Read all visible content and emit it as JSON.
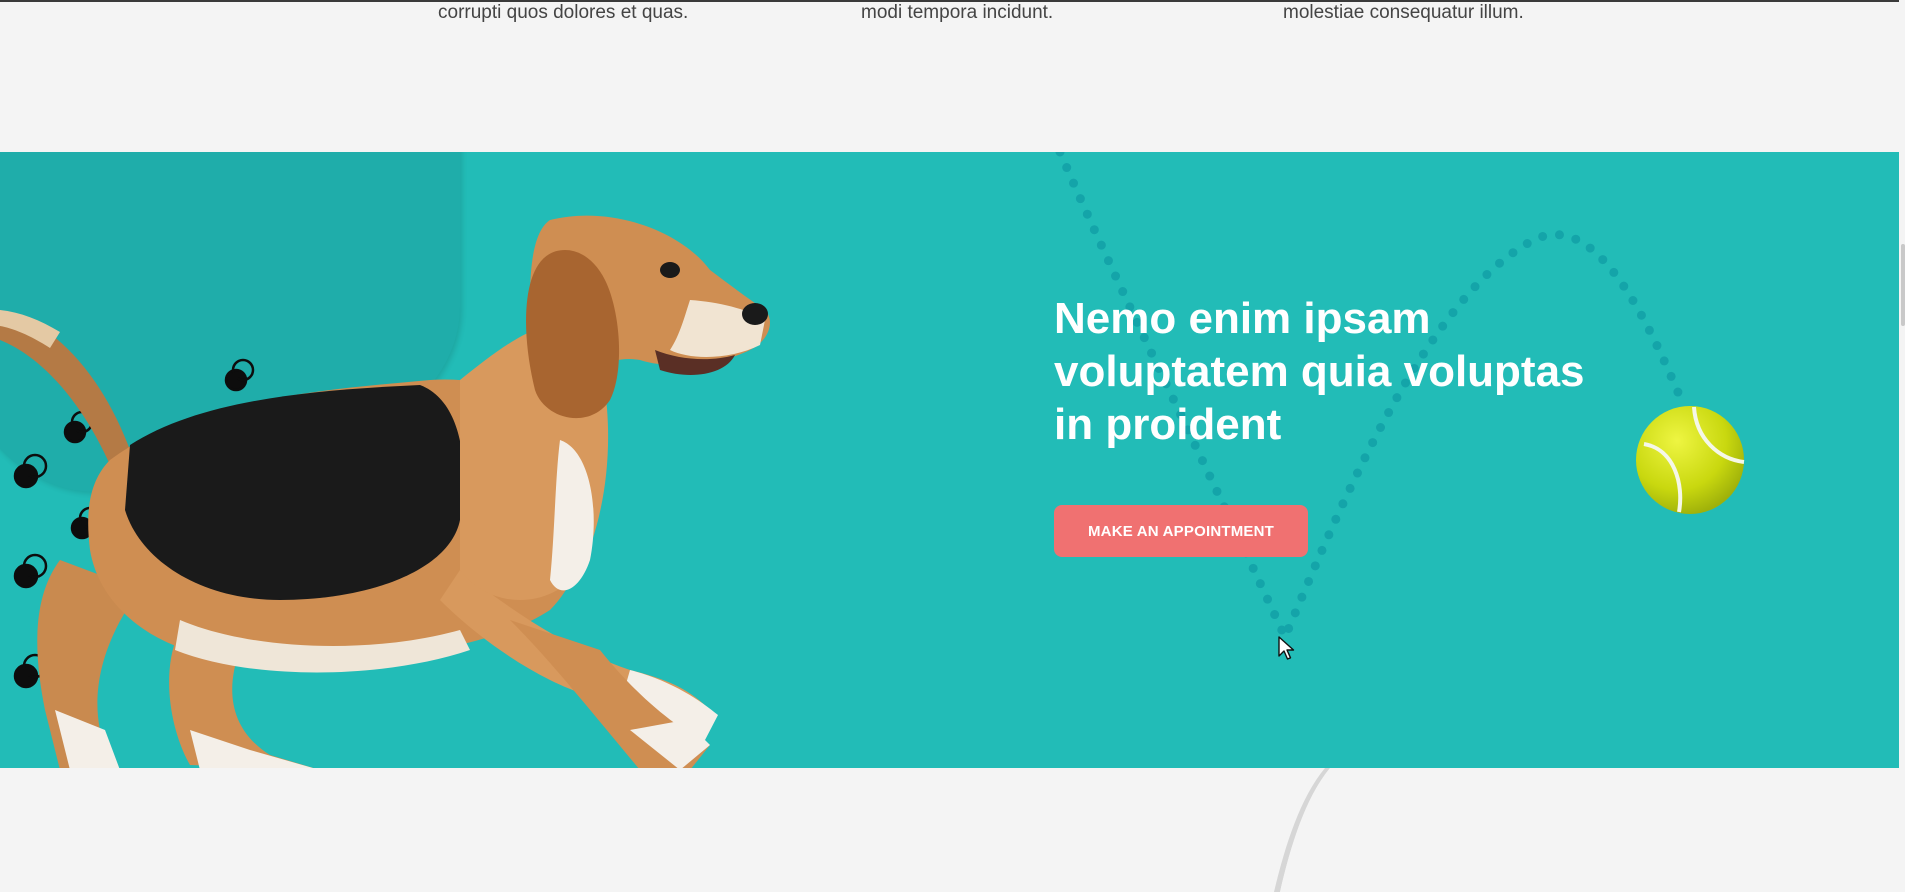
{
  "features": [
    {
      "text": "corrupti quos dolores et quas."
    },
    {
      "text": "modi tempora incidunt."
    },
    {
      "text": "molestiae consequatur illum."
    }
  ],
  "hero": {
    "headline": "Nemo enim ipsam voluptatem quia voluptas in proident",
    "cta_label": "MAKE AN APPOINTMENT"
  },
  "colors": {
    "hero_bg": "#22bcb7",
    "cta_bg": "#f07171",
    "page_bg": "#f4f4f4",
    "text_white": "#ffffff"
  },
  "icons": [
    "beagle-dog-image",
    "tennis-ball-image",
    "mouse-cursor-icon",
    "dotted-trail-decoration",
    "circle-pattern-decoration"
  ]
}
